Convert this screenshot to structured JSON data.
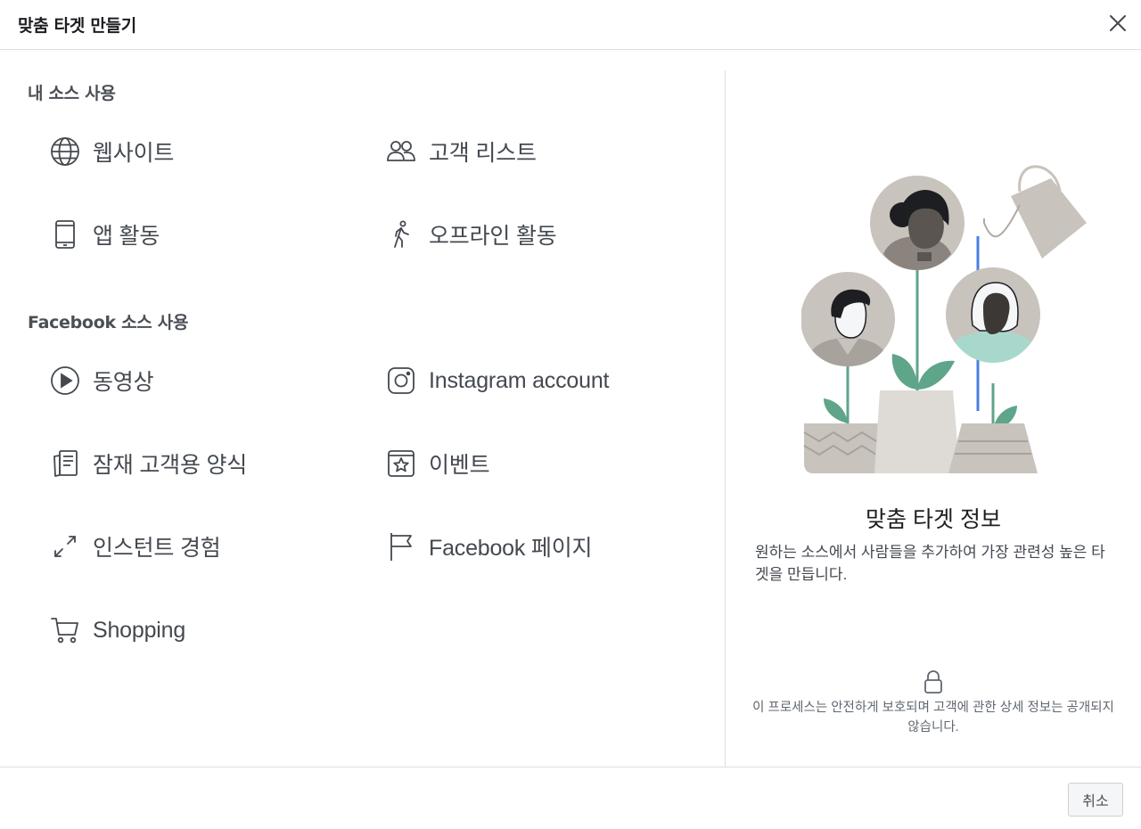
{
  "dialog": {
    "title": "맞춤 타겟 만들기"
  },
  "own_sources": {
    "heading": "내 소스 사용",
    "items": [
      {
        "label": "웹사이트",
        "icon": "globe-icon"
      },
      {
        "label": "고객 리스트",
        "icon": "people-icon"
      },
      {
        "label": "앱 활동",
        "icon": "mobile-icon"
      },
      {
        "label": "오프라인 활동",
        "icon": "walking-person-icon"
      }
    ]
  },
  "facebook_sources": {
    "heading": "Facebook 소스 사용",
    "items": [
      {
        "label": "동영상",
        "icon": "play-icon"
      },
      {
        "label": "Instagram account",
        "icon": "instagram-icon"
      },
      {
        "label": "잠재 고객용 양식",
        "icon": "form-icon"
      },
      {
        "label": "이벤트",
        "icon": "event-star-icon"
      },
      {
        "label": "인스턴트 경험",
        "icon": "expand-icon"
      },
      {
        "label": "Facebook 페이지",
        "icon": "flag-icon"
      },
      {
        "label": "Shopping",
        "icon": "cart-icon"
      }
    ]
  },
  "info_panel": {
    "title": "맞춤 타겟 정보",
    "description": "원하는 소스에서 사람들을 추가하여 가장 관련성 높은 타겟을 만듭니다.",
    "privacy_note": "이 프로세스는 안전하게 보호되며 고객에 관한 상세 정보는 공개되지 않습니다."
  },
  "footer": {
    "cancel_label": "취소"
  },
  "colors": {
    "text_primary": "#1c1e21",
    "text_secondary": "#444950",
    "border": "#dddfe2",
    "illustration_green": "#5fa58a",
    "illustration_grey": "#c9c3bd",
    "illustration_blue": "#4a7fe0"
  }
}
